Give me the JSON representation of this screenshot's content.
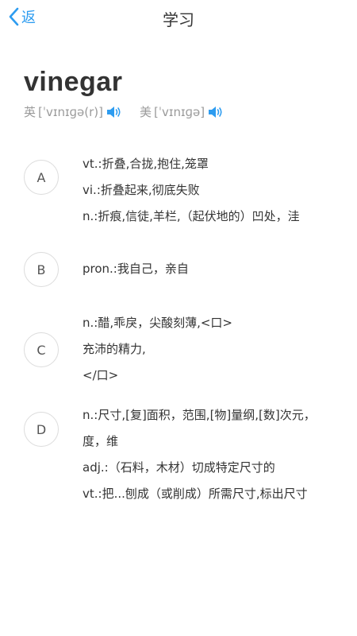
{
  "header": {
    "back_label": "返",
    "title": "学习"
  },
  "word": "vinegar",
  "phonetics": [
    {
      "label": "英",
      "ipa": "[ˈvɪnɪɡə(r)]",
      "icon": "speaker-icon"
    },
    {
      "label": "美",
      "ipa": "[ˈvɪnɪɡə]",
      "icon": "speaker-icon"
    }
  ],
  "colors": {
    "accent": "#2d9cf0",
    "muted": "#9a9a9a",
    "text": "#333333"
  },
  "options": [
    {
      "letter": "A",
      "lines": [
        "vt.:折叠,合拢,抱住,笼罩",
        "vi.:折叠起来,彻底失败",
        "n.:折痕,信徒,羊栏,（起伏地的）凹处，洼"
      ]
    },
    {
      "letter": "B",
      "lines": [
        "pron.:我自己，亲自"
      ]
    },
    {
      "letter": "C",
      "lines": [
        "n.:醋,乖戾，尖酸刻薄,<口>",
        "充沛的精力,",
        "</口>"
      ]
    },
    {
      "letter": "D",
      "lines": [
        "n.:尺寸,[复]面积，范围,[物]量纲,[数]次元，",
        "度，维",
        "adj.:（石料，木材）切成特定尺寸的",
        "vt.:把...刨成（或削成）所需尺寸,标出尺寸"
      ]
    }
  ]
}
